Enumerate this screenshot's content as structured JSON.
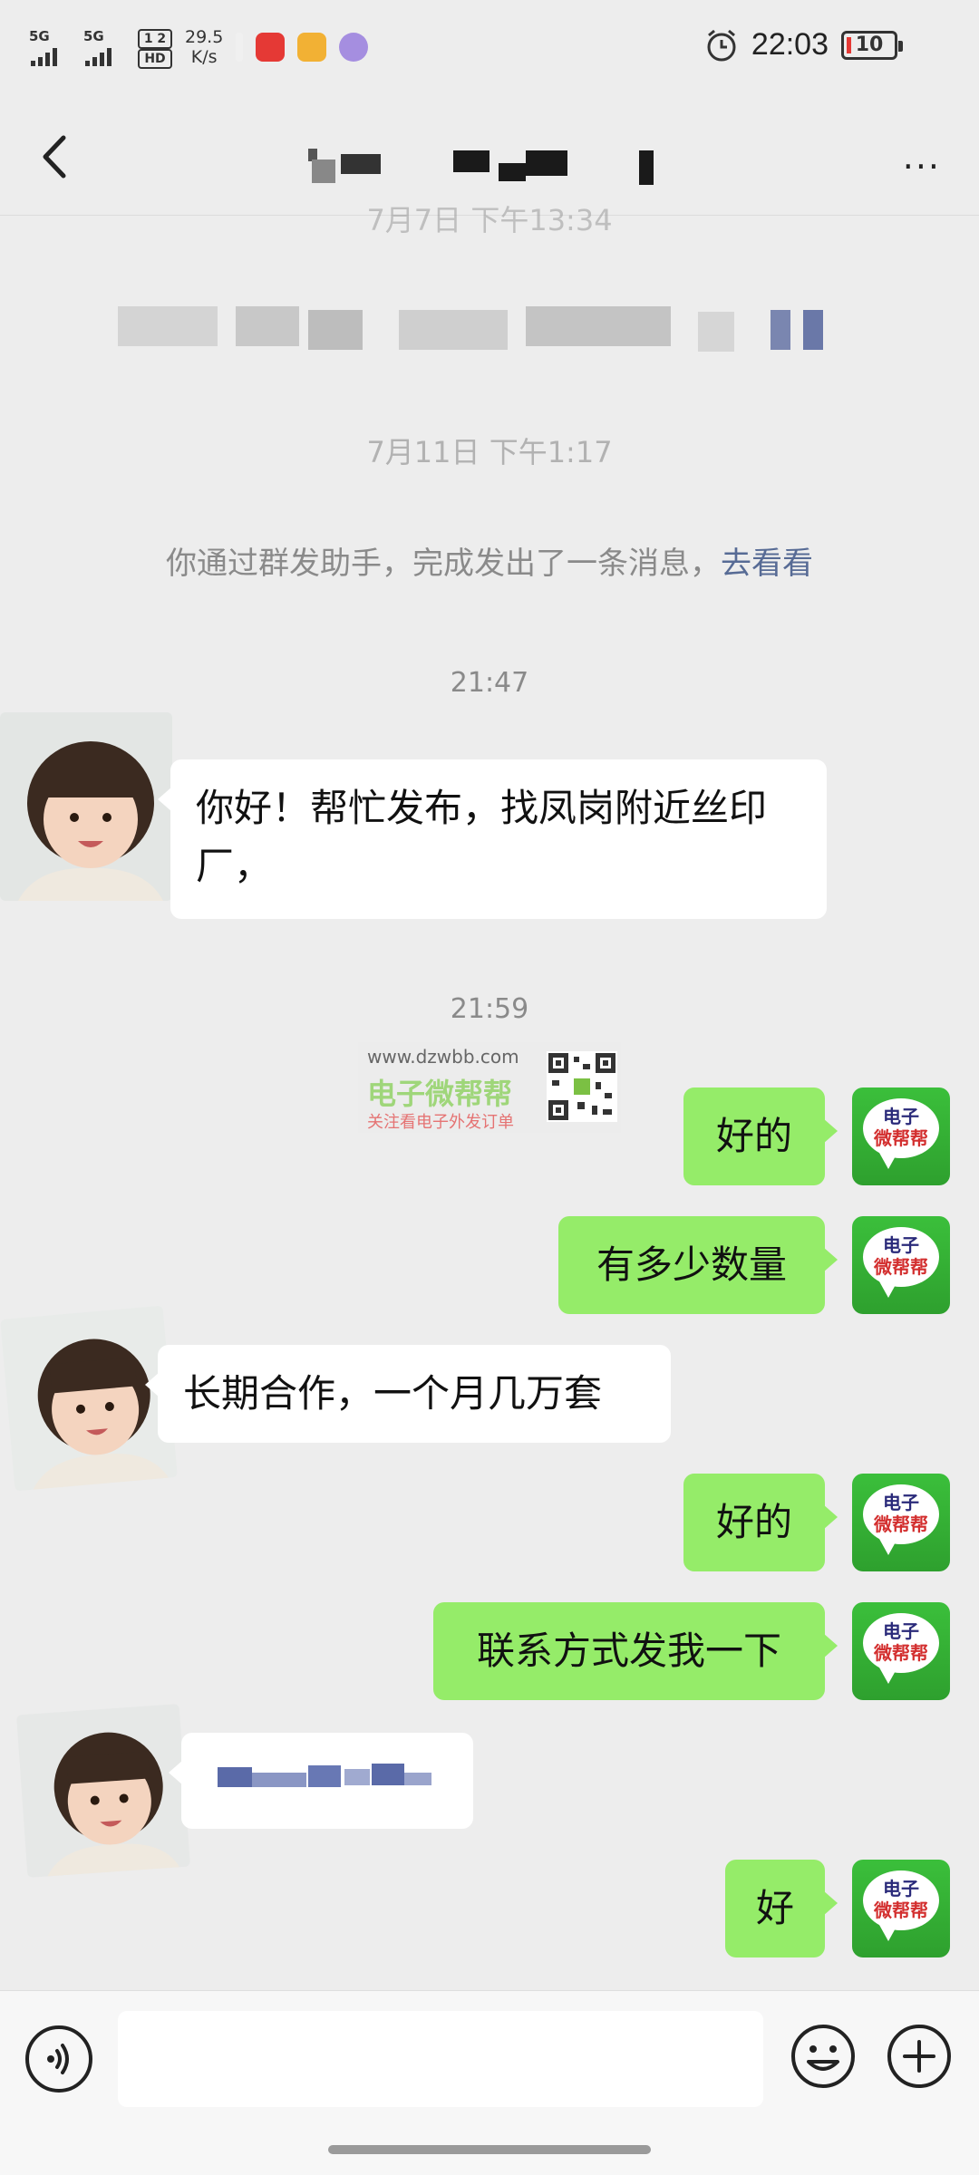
{
  "status": {
    "signal1": "5G",
    "signal2": "5G",
    "hd_top": "1 2",
    "hd_bottom": "HD",
    "speed_value": "29.5",
    "speed_unit": "K/s",
    "time": "22:03",
    "battery": "10"
  },
  "header": {
    "more": "···"
  },
  "history": {
    "time1": "7月7日 下午13:34",
    "line1": "你通过群发助手",
    "time2": "7月11日 下午1:17",
    "line2": "你通过群发助手，完成发出了一条消息",
    "link": "去看看"
  },
  "watermark": {
    "url": "www.dzwbb.com",
    "name": "电子微帮帮",
    "sub": "关注看电子外发订单"
  },
  "me_avatar": {
    "line1": "电子",
    "line2": "微帮帮"
  },
  "messages": {
    "t1": "21:47",
    "m1": "你好！帮忙发布，找凤岗附近丝印厂，",
    "t2": "21:59",
    "m2": "好的",
    "m3": "有多少数量",
    "m4": "长期合作，一个月几万套",
    "m5": "好的",
    "m6": "联系方式发我一下",
    "m8": "好"
  },
  "colors": {
    "background": "#ededed",
    "outgoing_bubble": "#95ec69",
    "incoming_bubble": "#ffffff",
    "link": "#576b95"
  }
}
